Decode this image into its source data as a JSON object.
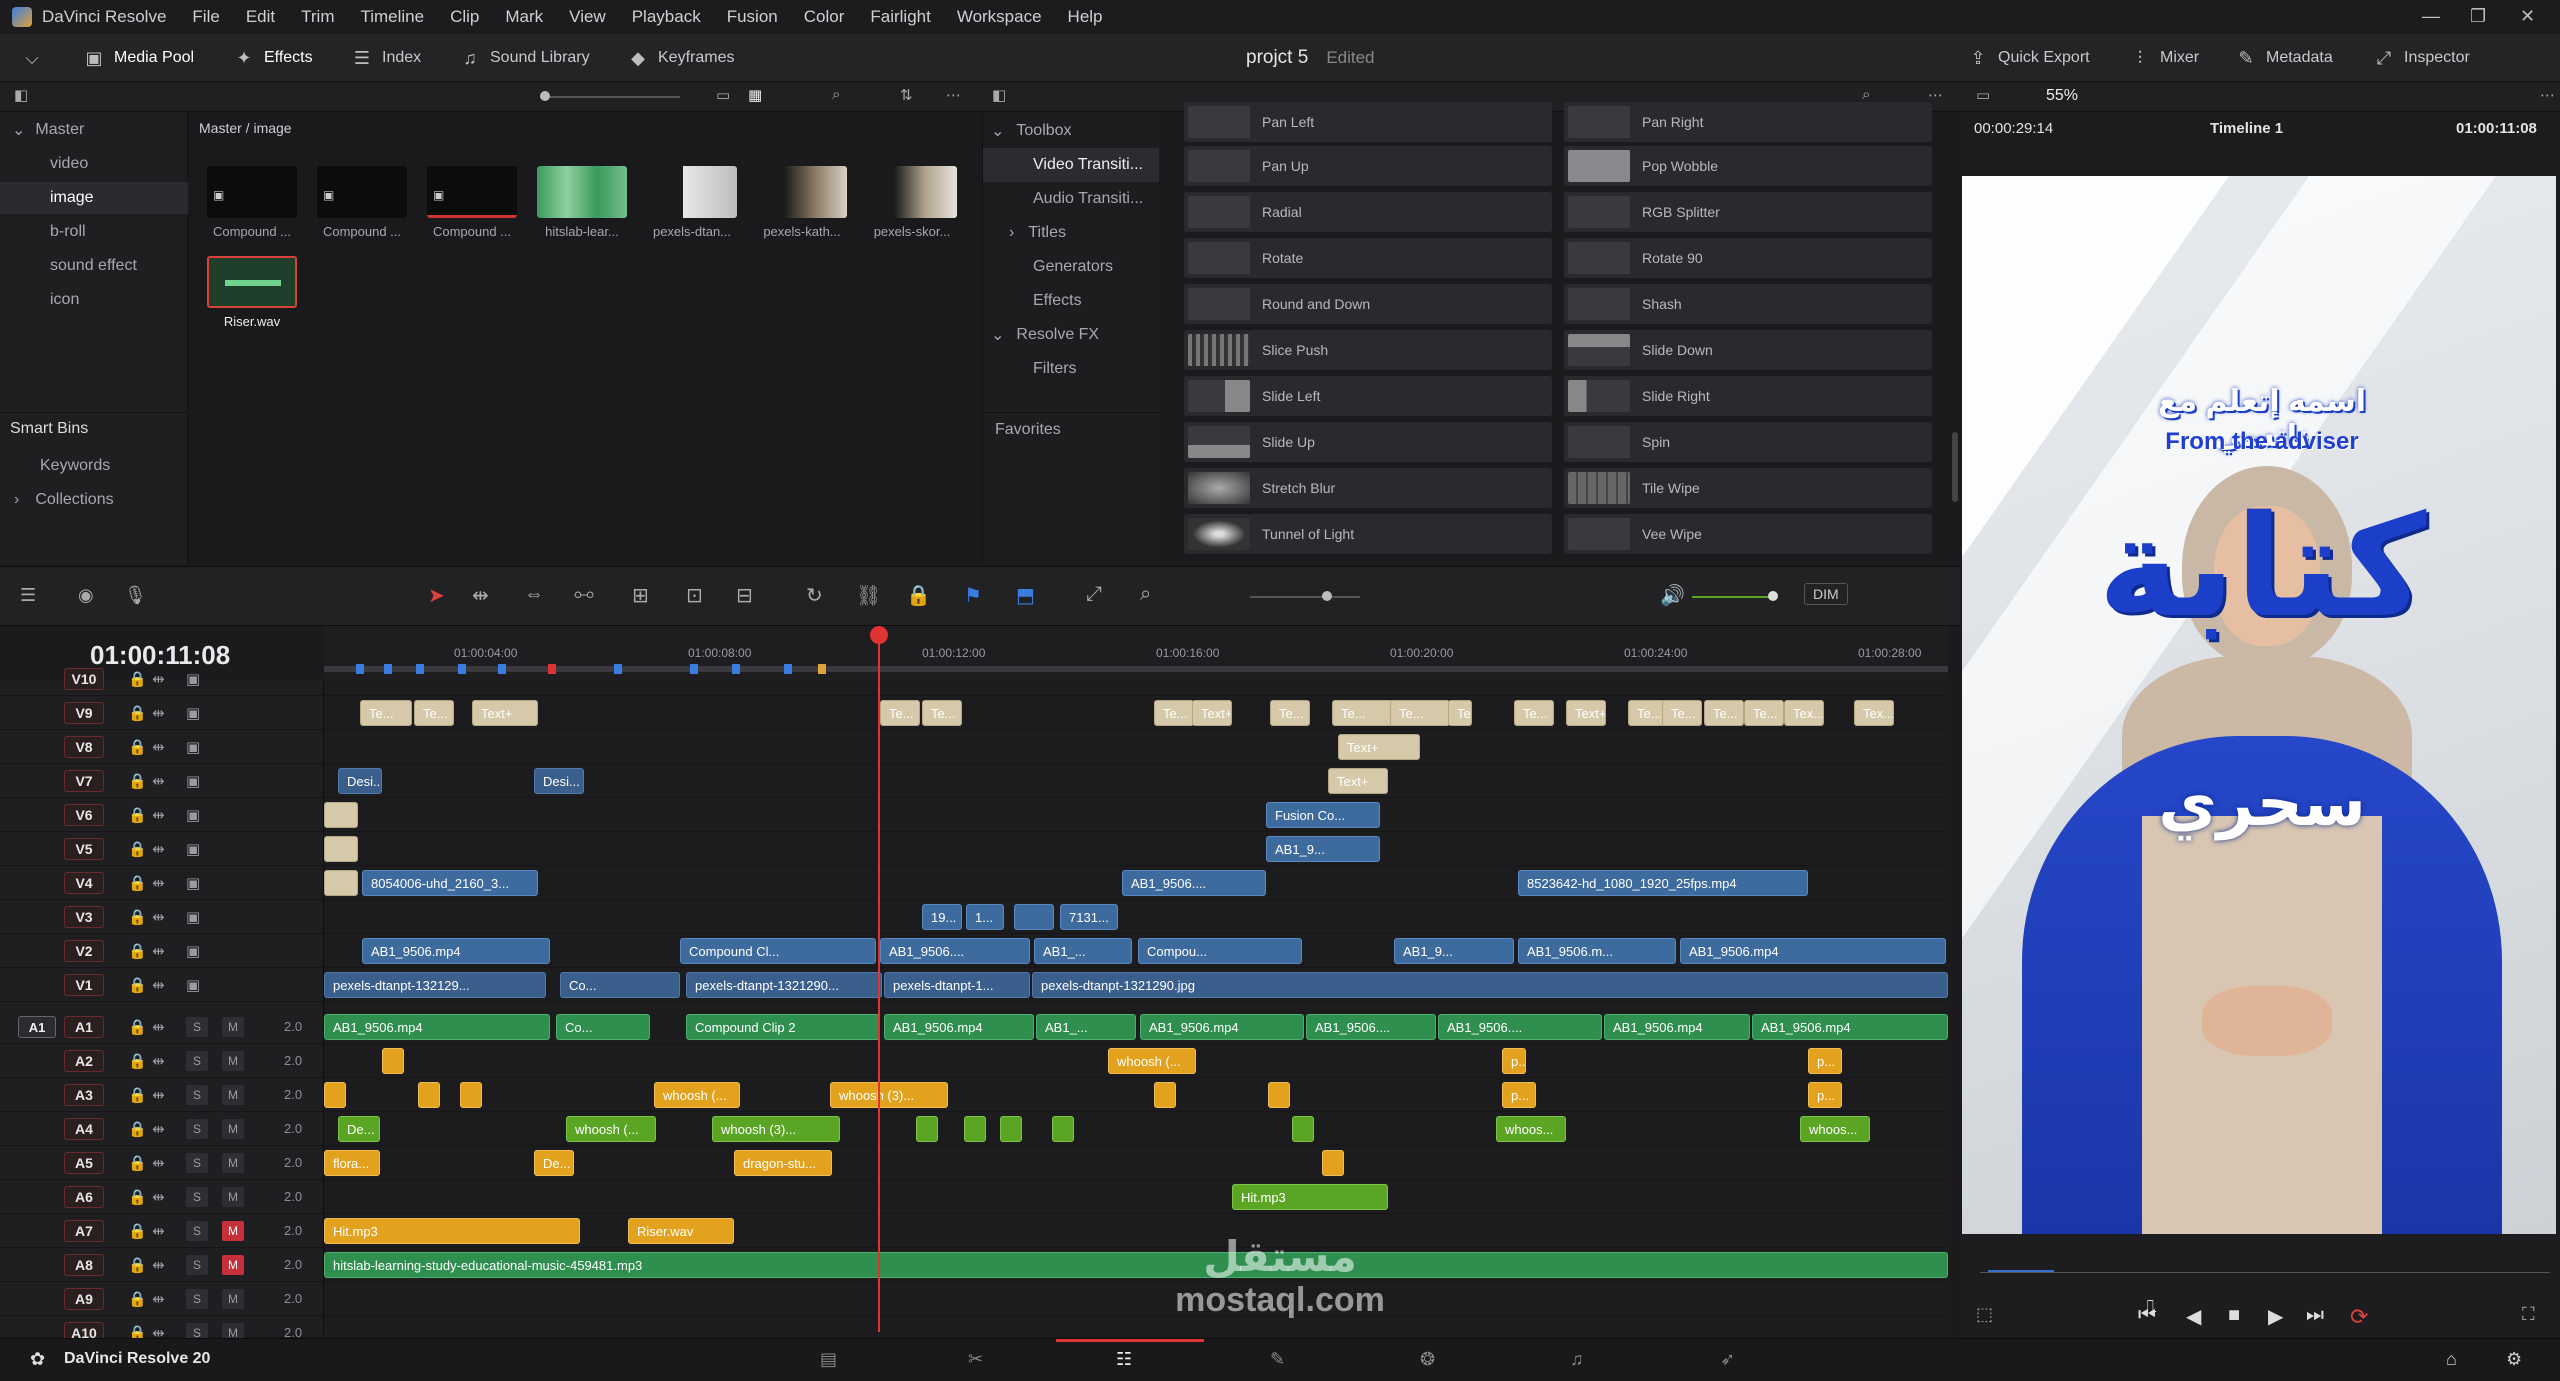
{
  "menubar": {
    "app": "DaVinci Resolve",
    "items": [
      "File",
      "Edit",
      "Trim",
      "Timeline",
      "Clip",
      "Mark",
      "View",
      "Playback",
      "Fusion",
      "Color",
      "Fairlight",
      "Workspace",
      "Help"
    ]
  },
  "toolbar": {
    "media_pool": "Media Pool",
    "effects": "Effects",
    "index": "Index",
    "sound_library": "Sound Library",
    "keyframes": "Keyframes",
    "quick_export": "Quick Export",
    "mixer": "Mixer",
    "metadata": "Metadata",
    "inspector": "Inspector"
  },
  "project": {
    "name": "projct 5",
    "state": "Edited"
  },
  "viewer": {
    "zoom": "55%",
    "source_tc": "00:00:29:14",
    "timeline_name": "Timeline 1",
    "record_tc": "01:00:11:08"
  },
  "bins": {
    "master": "Master",
    "items": [
      "video",
      "image",
      "b-roll",
      "sound effect",
      "icon"
    ],
    "smart_bins": "Smart Bins",
    "keywords": "Keywords",
    "collections": "Collections"
  },
  "mediapool": {
    "path": "Master / image",
    "clips": [
      "Compound ...",
      "Compound ...",
      "Compound ...",
      "hitslab-lear...",
      "pexels-dtan...",
      "pexels-kath...",
      "pexels-skor...",
      "Riser.wav"
    ]
  },
  "fxnav": {
    "toolbox": "Toolbox",
    "video_transitions": "Video Transiti...",
    "audio_transitions": "Audio Transiti...",
    "titles": "Titles",
    "generators": "Generators",
    "effects": "Effects",
    "resolve_fx": "Resolve FX",
    "filters": "Filters",
    "favorites": "Favorites"
  },
  "fxlist": {
    "left": [
      "Pan Left",
      "Pan Up",
      "Radial",
      "Rotate",
      "Round and Down",
      "Slice Push",
      "Slide Left",
      "Slide Up",
      "Stretch Blur",
      "Tunnel of Light"
    ],
    "right": [
      "Pan Right",
      "Pop Wobble",
      "RGB Splitter",
      "Rotate 90",
      "Shash",
      "Slide Down",
      "Slide Right",
      "Spin",
      "Tile Wipe",
      "Vee Wipe"
    ]
  },
  "timeline": {
    "timecode": "01:00:11:08",
    "dim": "DIM",
    "ruler": [
      "01:00:04:00",
      "01:00:08:00",
      "01:00:12:00",
      "01:00:16:00",
      "01:00:20:00",
      "01:00:24:00",
      "01:00:28:00"
    ],
    "video_tracks": [
      "V10",
      "V9",
      "V8",
      "V7",
      "V6",
      "V5",
      "V4",
      "V3",
      "V2",
      "V1"
    ],
    "audio_tracks": [
      "A1",
      "A2",
      "A3",
      "A4",
      "A5",
      "A6",
      "A7",
      "A8",
      "A9",
      "A10"
    ],
    "audio_patch": "A1",
    "audio_level": "2.0",
    "solo": "S",
    "mute": "M"
  },
  "clips": {
    "v9": [
      "Te...",
      "Te...",
      "Text+",
      "Te...",
      "Te...",
      "Te...",
      "Text+",
      "Te...",
      "Te...",
      "Te...",
      "Te...",
      "Te...",
      "Text+",
      "Te...",
      "Te...",
      "Te...",
      "Te...",
      "Tex...",
      "Tex..."
    ],
    "v8": "Text+",
    "v7": [
      "Desi...",
      "Desi...",
      "Text+"
    ],
    "v6": "Fusion Co...",
    "v5": "AB1_9...",
    "v4": [
      "8054006-uhd_2160_3...",
      "AB1_9506....",
      "8523642-hd_1080_1920_25fps.mp4"
    ],
    "v3": [
      "19...",
      "1...",
      "7131..."
    ],
    "v2": [
      "AB1_9506.mp4",
      "Compound Cl...",
      "AB1_9506....",
      "AB1_...",
      "Compou...",
      "AB1_9...",
      "AB1_9506.m...",
      "AB1_9506.mp4"
    ],
    "v1": [
      "pexels-dtanpt-132129...",
      "Co...",
      "pexels-dtanpt-1321290...",
      "pexels-dtanpt-1...",
      "pexels-dtanpt-1321290.jpg"
    ],
    "a1": [
      "AB1_9506.mp4",
      "Co...",
      "Compound Clip 2",
      "AB1_9506.mp4",
      "AB1_...",
      "AB1_9506.mp4",
      "AB1_9506....",
      "AB1_9506....",
      "AB1_9506.mp4",
      "AB1_9506.mp4"
    ],
    "a2": [
      "whoosh (...",
      "p...",
      "p..."
    ],
    "a3": [
      "whoosh (...",
      "whoosh (3)...",
      "p...",
      "p..."
    ],
    "a4": [
      "De...",
      "whoosh (...",
      "whoosh (3)...",
      "whoos...",
      "whoos..."
    ],
    "a5": [
      "flora...",
      "De...",
      "dragon-stu..."
    ],
    "a6": "Hit.mp3",
    "a7": [
      "Hit.mp3",
      "Riser.wav"
    ],
    "a8": "hitslab-learning-study-educational-music-459481.mp3"
  },
  "overlay": {
    "arabic_title": "اسمه إتعلم مع ناتسي",
    "subtitle": "From the adviser",
    "big_word": "كتابة",
    "word2": "سحري"
  },
  "watermark": {
    "arabic": "مستقل",
    "latin": "mostaql.com"
  },
  "bottom": {
    "app": "DaVinci Resolve 20"
  }
}
